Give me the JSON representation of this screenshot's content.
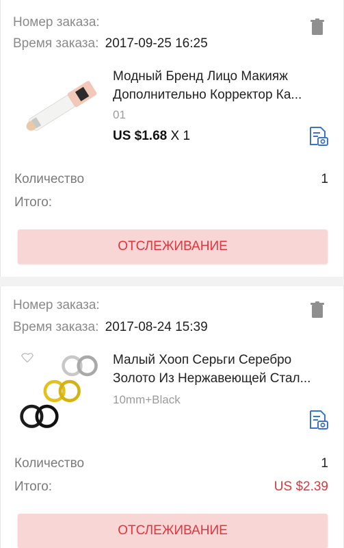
{
  "colors": {
    "accent_red": "#e0353b",
    "button_bg": "#f9d6d6",
    "icon_blue": "#3b73c9"
  },
  "orders": [
    {
      "order_number_label": "Номер заказа:",
      "order_number_value": "",
      "order_time_label": "Время заказа:",
      "order_time_value": "2017-09-25 16:25",
      "product_title_line1": "Модный Бренд Лицо Макияж",
      "product_title_line2": "Дополнительно Корректор Ка...",
      "variant": "01",
      "price": "US $1.68",
      "multiplier": "X 1",
      "quantity_label": "Количество",
      "quantity_value": "1",
      "total_label": "Итого:",
      "total_value": "",
      "track_button": "ОТСЛЕЖИВАНИЕ",
      "thumb_icon": "concealer-pen-image"
    },
    {
      "order_number_label": "Номер заказа:",
      "order_number_value": "",
      "order_time_label": "Время заказа:",
      "order_time_value": "2017-08-24 15:39",
      "product_title_line1": "Малый Хооп Серьги Серебро",
      "product_title_line2": "Золото Из Нержавеющей Стал...",
      "variant": "10mm+Black",
      "quantity_label": "Количество",
      "quantity_value": "1",
      "total_label": "Итого:",
      "total_value": "US $2.39",
      "track_button": "ОТСЛЕЖИВАНИЕ",
      "thumb_icon": "hoop-earrings-image"
    }
  ]
}
